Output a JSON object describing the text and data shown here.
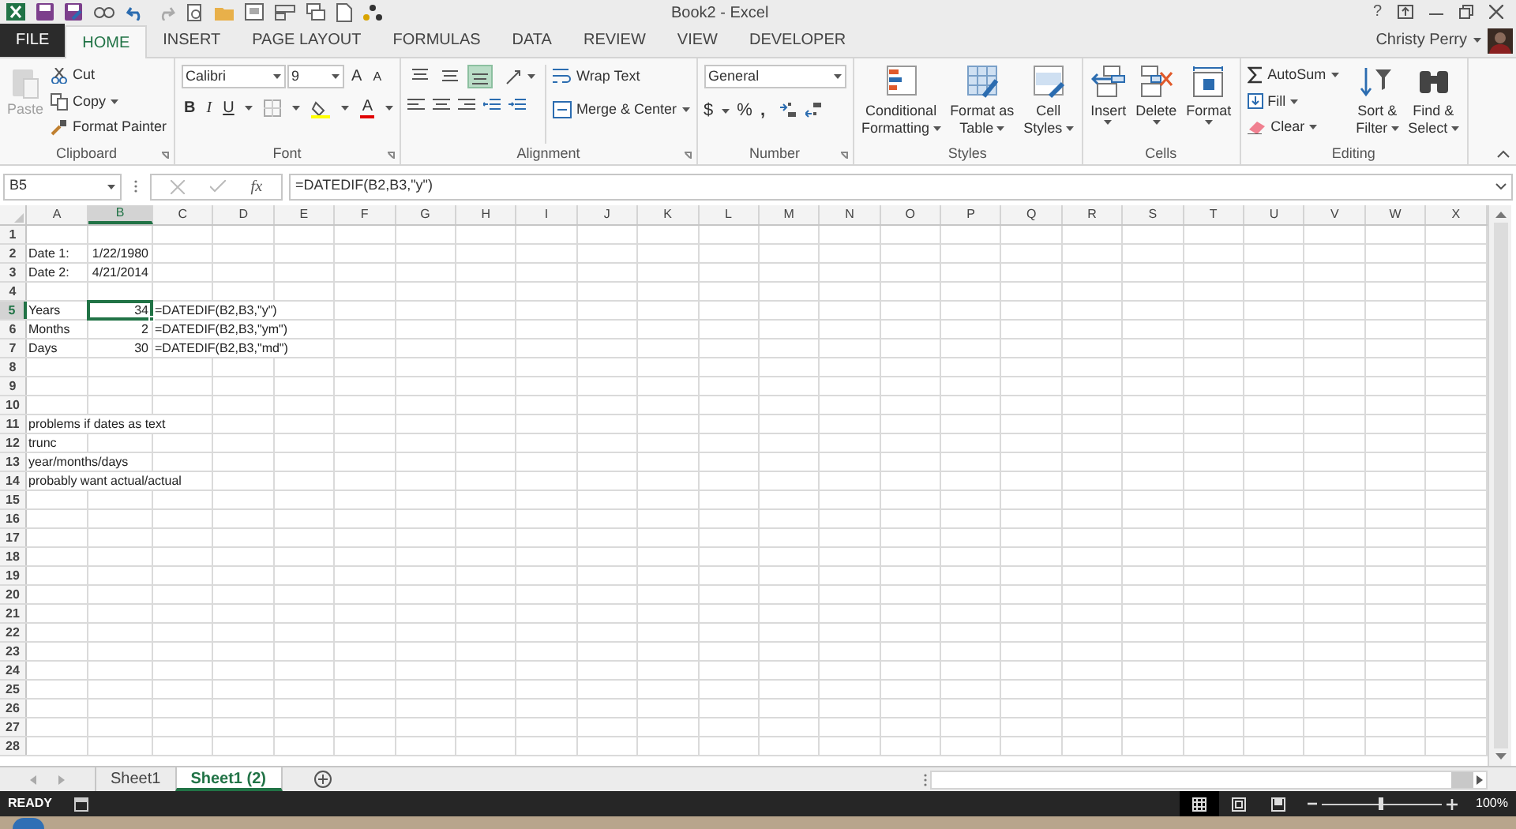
{
  "window": {
    "title": "Book2 - Excel",
    "help": "?",
    "user": "Christy Perry"
  },
  "tabs": [
    {
      "label": "FILE",
      "kind": "file",
      "selected": false
    },
    {
      "label": "HOME",
      "kind": "tab",
      "selected": true
    },
    {
      "label": "INSERT",
      "kind": "tab",
      "selected": false
    },
    {
      "label": "PAGE LAYOUT",
      "kind": "tab",
      "selected": false
    },
    {
      "label": "FORMULAS",
      "kind": "tab",
      "selected": false
    },
    {
      "label": "DATA",
      "kind": "tab",
      "selected": false
    },
    {
      "label": "REVIEW",
      "kind": "tab",
      "selected": false
    },
    {
      "label": "VIEW",
      "kind": "tab",
      "selected": false
    },
    {
      "label": "DEVELOPER",
      "kind": "tab",
      "selected": false
    }
  ],
  "clipboard": {
    "label": "Clipboard",
    "paste": {
      "label": "Paste",
      "disabled": true
    },
    "cut": "Cut",
    "copy": "Copy",
    "format_painter": "Format Painter"
  },
  "font": {
    "label": "Font",
    "name": "Calibri",
    "size": "9",
    "grow": "A",
    "shrink": "A",
    "style_buttons": [
      "B",
      "I",
      "U"
    ],
    "font_color": "A"
  },
  "alignment": {
    "label": "Alignment",
    "vertical": [
      {
        "selected": false
      },
      {
        "selected": false
      },
      {
        "selected": true
      }
    ],
    "wrap_text": "Wrap Text",
    "merge_center": "Merge & Center"
  },
  "number": {
    "label": "Number",
    "format": "General",
    "currency": "$",
    "percent": "%",
    "comma": ","
  },
  "styles": {
    "label": "Styles",
    "buttons": [
      [
        "Conditional",
        "Formatting"
      ],
      [
        "Format as",
        "Table"
      ],
      [
        "Cell",
        "Styles"
      ]
    ]
  },
  "cells": {
    "label": "Cells",
    "buttons": [
      "Insert",
      "Delete",
      "Format"
    ]
  },
  "editing": {
    "label": "Editing",
    "autosum": "AutoSum",
    "fill": "Fill",
    "clear": "Clear",
    "buttons": [
      [
        "Sort &",
        "Filter"
      ],
      [
        "Find &",
        "Select"
      ]
    ]
  },
  "formula_bar": {
    "name_box": "B5",
    "function_label": "fx",
    "formula": "=DATEDIF(B2,B3,\"y\")"
  },
  "columns": [
    {
      "label": "A",
      "selected": false
    },
    {
      "label": "B",
      "selected": true
    },
    {
      "label": "C",
      "selected": false
    },
    {
      "label": "D",
      "selected": false
    },
    {
      "label": "E",
      "selected": false
    },
    {
      "label": "F",
      "selected": false
    },
    {
      "label": "G",
      "selected": false
    },
    {
      "label": "H",
      "selected": false
    },
    {
      "label": "I",
      "selected": false
    },
    {
      "label": "J",
      "selected": false
    },
    {
      "label": "K",
      "selected": false
    },
    {
      "label": "L",
      "selected": false
    },
    {
      "label": "M",
      "selected": false
    },
    {
      "label": "N",
      "selected": false
    },
    {
      "label": "O",
      "selected": false
    },
    {
      "label": "P",
      "selected": false
    },
    {
      "label": "Q",
      "selected": false
    },
    {
      "label": "R",
      "selected": false
    },
    {
      "label": "S",
      "selected": false
    },
    {
      "label": "T",
      "selected": false
    },
    {
      "label": "U",
      "selected": false
    },
    {
      "label": "V",
      "selected": false
    },
    {
      "label": "W",
      "selected": false
    },
    {
      "label": "X",
      "selected": false
    }
  ],
  "rows": [
    {
      "label": "1",
      "selected": false,
      "cells": []
    },
    {
      "label": "2",
      "selected": false,
      "cells": [
        {
          "text": "Date 1:",
          "kind": "text",
          "selected": false
        },
        {
          "text": "1/22/1980",
          "kind": "number",
          "selected": false
        }
      ]
    },
    {
      "label": "3",
      "selected": false,
      "cells": [
        {
          "text": "Date 2:",
          "kind": "text",
          "selected": false
        },
        {
          "text": "4/21/2014",
          "kind": "number",
          "selected": false
        }
      ]
    },
    {
      "label": "4",
      "selected": false,
      "cells": []
    },
    {
      "label": "5",
      "selected": true,
      "cells": [
        {
          "text": "Years",
          "kind": "text",
          "selected": false
        },
        {
          "text": "34",
          "kind": "number",
          "selected": true
        },
        {
          "text": "=DATEDIF(B2,B3,\"y\")",
          "kind": "text",
          "selected": false
        }
      ]
    },
    {
      "label": "6",
      "selected": false,
      "cells": [
        {
          "text": "Months",
          "kind": "text",
          "selected": false
        },
        {
          "text": "2",
          "kind": "number",
          "selected": false
        },
        {
          "text": "=DATEDIF(B2,B3,\"ym\")",
          "kind": "text",
          "selected": false
        }
      ]
    },
    {
      "label": "7",
      "selected": false,
      "cells": [
        {
          "text": "Days",
          "kind": "text",
          "selected": false
        },
        {
          "text": "30",
          "kind": "number",
          "selected": false
        },
        {
          "text": "=DATEDIF(B2,B3,\"md\")",
          "kind": "text",
          "selected": false
        }
      ]
    },
    {
      "label": "8",
      "selected": false,
      "cells": []
    },
    {
      "label": "9",
      "selected": false,
      "cells": []
    },
    {
      "label": "10",
      "selected": false,
      "cells": []
    },
    {
      "label": "11",
      "selected": false,
      "cells": [
        {
          "text": "problems if dates as text",
          "kind": "text",
          "selected": false
        }
      ]
    },
    {
      "label": "12",
      "selected": false,
      "cells": [
        {
          "text": "trunc",
          "kind": "text",
          "selected": false
        }
      ]
    },
    {
      "label": "13",
      "selected": false,
      "cells": [
        {
          "text": "year/months/days",
          "kind": "text",
          "selected": false
        }
      ]
    },
    {
      "label": "14",
      "selected": false,
      "cells": [
        {
          "text": "probably want actual/actual",
          "kind": "text",
          "selected": false
        }
      ]
    },
    {
      "label": "15",
      "selected": false,
      "cells": []
    },
    {
      "label": "16",
      "selected": false,
      "cells": []
    },
    {
      "label": "17",
      "selected": false,
      "cells": []
    },
    {
      "label": "18",
      "selected": false,
      "cells": []
    },
    {
      "label": "19",
      "selected": false,
      "cells": []
    },
    {
      "label": "20",
      "selected": false,
      "cells": []
    },
    {
      "label": "21",
      "selected": false,
      "cells": []
    },
    {
      "label": "22",
      "selected": false,
      "cells": []
    },
    {
      "label": "23",
      "selected": false,
      "cells": []
    },
    {
      "label": "24",
      "selected": false,
      "cells": []
    },
    {
      "label": "25",
      "selected": false,
      "cells": []
    },
    {
      "label": "26",
      "selected": false,
      "cells": []
    },
    {
      "label": "27",
      "selected": false,
      "cells": []
    },
    {
      "label": "28",
      "selected": false,
      "cells": []
    }
  ],
  "sheets": [
    {
      "label": "Sheet1",
      "selected": false
    },
    {
      "label": "Sheet1 (2)",
      "selected": true
    }
  ],
  "status_bar": {
    "status": "READY",
    "zoom": {
      "level": 0.5
    },
    "zoom_reading": "100%"
  }
}
